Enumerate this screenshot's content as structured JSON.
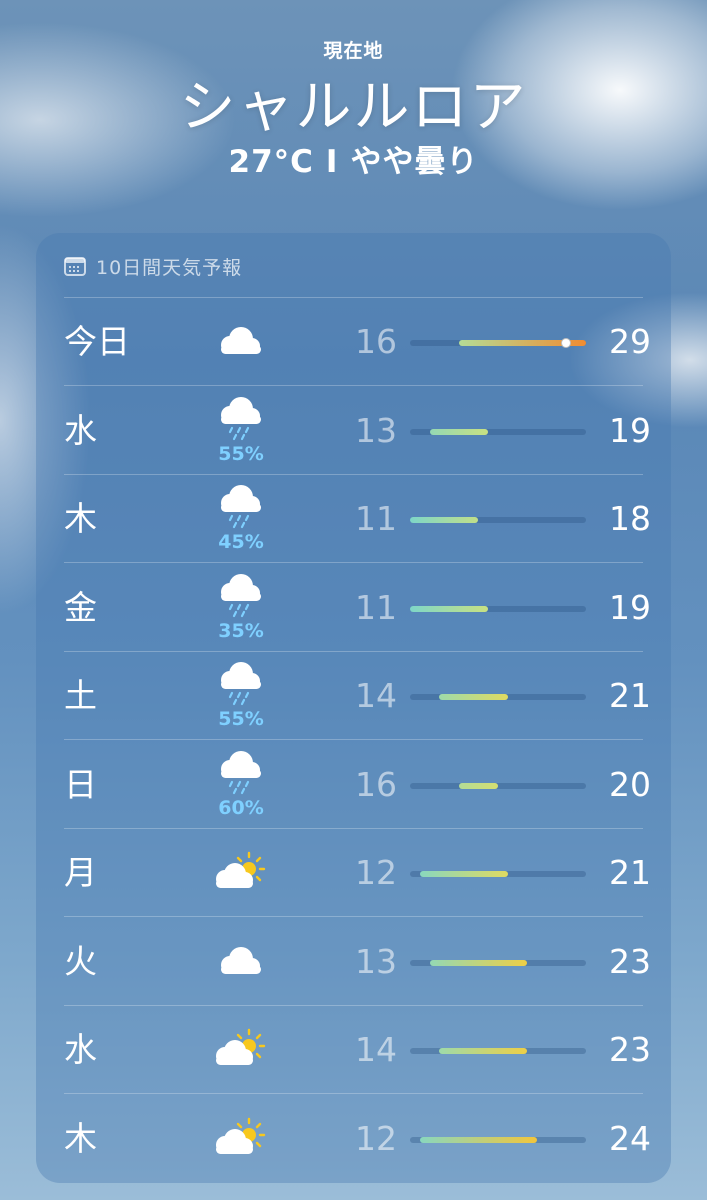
{
  "header": {
    "location_label": "現在地",
    "city": "シャルルロア",
    "temperature": "27°C",
    "separator": "I",
    "condition": "やや曇り"
  },
  "forecast": {
    "title": "10日間天気予報",
    "icon": "calendar-icon",
    "range_min": 11,
    "range_max": 29,
    "current_temp": 27,
    "days": [
      {
        "day": "今日",
        "icon": "cloud",
        "precip": "",
        "low": "16",
        "high": "29"
      },
      {
        "day": "水",
        "icon": "cloud-rain",
        "precip": "55%",
        "low": "13",
        "high": "19"
      },
      {
        "day": "木",
        "icon": "cloud-rain",
        "precip": "45%",
        "low": "11",
        "high": "18"
      },
      {
        "day": "金",
        "icon": "cloud-rain",
        "precip": "35%",
        "low": "11",
        "high": "19"
      },
      {
        "day": "土",
        "icon": "cloud-rain",
        "precip": "55%",
        "low": "14",
        "high": "21"
      },
      {
        "day": "日",
        "icon": "cloud-rain",
        "precip": "60%",
        "low": "16",
        "high": "20"
      },
      {
        "day": "月",
        "icon": "cloud-sun",
        "precip": "",
        "low": "12",
        "high": "21"
      },
      {
        "day": "火",
        "icon": "cloud",
        "precip": "",
        "low": "13",
        "high": "23"
      },
      {
        "day": "水",
        "icon": "cloud-sun",
        "precip": "",
        "low": "14",
        "high": "23"
      },
      {
        "day": "木",
        "icon": "cloud-sun",
        "precip": "",
        "low": "12",
        "high": "24"
      }
    ]
  }
}
